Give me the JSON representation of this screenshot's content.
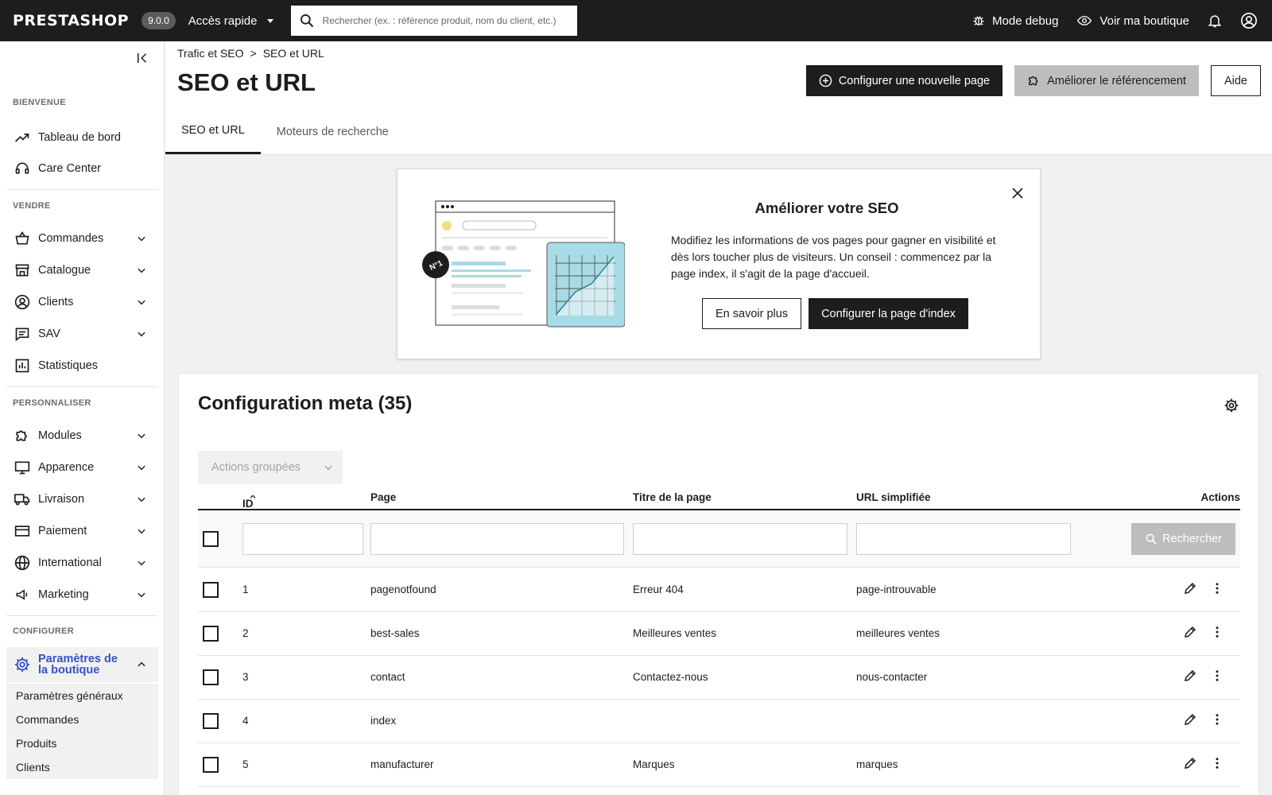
{
  "header": {
    "logo": "PRESTASHOP",
    "version": "9.0.0",
    "quick_access": "Accès rapide",
    "search_placeholder": "Rechercher (ex. : référence produit, nom du client, etc.)",
    "debug": "Mode debug",
    "view_shop": "Voir ma boutique"
  },
  "sidebar": {
    "sections": [
      "BIENVENUE",
      "VENDRE",
      "PERSONNALISER",
      "CONFIGURER"
    ],
    "welcome": [
      {
        "label": "Tableau de bord",
        "icon": "trending-up-icon"
      },
      {
        "label": "Care Center",
        "icon": "headset-icon"
      }
    ],
    "sell": [
      {
        "label": "Commandes",
        "icon": "basket-icon"
      },
      {
        "label": "Catalogue",
        "icon": "store-icon"
      },
      {
        "label": "Clients",
        "icon": "user-circle-icon"
      },
      {
        "label": "SAV",
        "icon": "chat-icon"
      },
      {
        "label": "Statistiques",
        "icon": "bar-chart-icon"
      }
    ],
    "customize": [
      {
        "label": "Modules",
        "icon": "puzzle-icon"
      },
      {
        "label": "Apparence",
        "icon": "monitor-icon"
      },
      {
        "label": "Livraison",
        "icon": "truck-icon"
      },
      {
        "label": "Paiement",
        "icon": "credit-card-icon"
      },
      {
        "label": "International",
        "icon": "globe-icon"
      },
      {
        "label": "Marketing",
        "icon": "megaphone-icon"
      }
    ],
    "configure_active": "Paramètres de la boutique",
    "configure_sub": [
      "Paramètres généraux",
      "Commandes",
      "Produits",
      "Clients"
    ]
  },
  "page": {
    "breadcrumb": [
      "Trafic et SEO",
      ">",
      "SEO et URL"
    ],
    "title": "SEO et URL",
    "btn_new_page": "Configurer une nouvelle page",
    "btn_improve": "Améliorer le référencement",
    "btn_help": "Aide",
    "tabs": [
      "SEO et URL",
      "Moteurs de recherche"
    ]
  },
  "seo_card": {
    "title": "Améliorer votre SEO",
    "description": "Modifiez les informations de vos pages pour gagner en visibilité et dès lors toucher plus de visiteurs. Un conseil : commencez par la page index, il s'agit de la page d'accueil.",
    "btn_learn": "En savoir plus",
    "btn_config_index": "Configurer la page d'index",
    "badge": "N°1"
  },
  "meta": {
    "title": "Configuration meta (35)",
    "bulk_actions": "Actions groupées",
    "columns": [
      "ID",
      "Page",
      "Titre de la page",
      "URL simplifiée",
      "Actions"
    ],
    "search_btn": "Rechercher",
    "rows": [
      {
        "id": "1",
        "page": "pagenotfound",
        "title": "Erreur 404",
        "url": "page-introuvable"
      },
      {
        "id": "2",
        "page": "best-sales",
        "title": "Meilleures ventes",
        "url": "meilleures ventes"
      },
      {
        "id": "3",
        "page": "contact",
        "title": "Contactez-nous",
        "url": "nous-contacter"
      },
      {
        "id": "4",
        "page": "index",
        "title": "",
        "url": ""
      },
      {
        "id": "5",
        "page": "manufacturer",
        "title": "Marques",
        "url": "marques"
      }
    ]
  },
  "colors": {
    "dark": "#1d1d1b",
    "accent": "#3753c4",
    "illustration_blue": "#a8dbe5"
  }
}
